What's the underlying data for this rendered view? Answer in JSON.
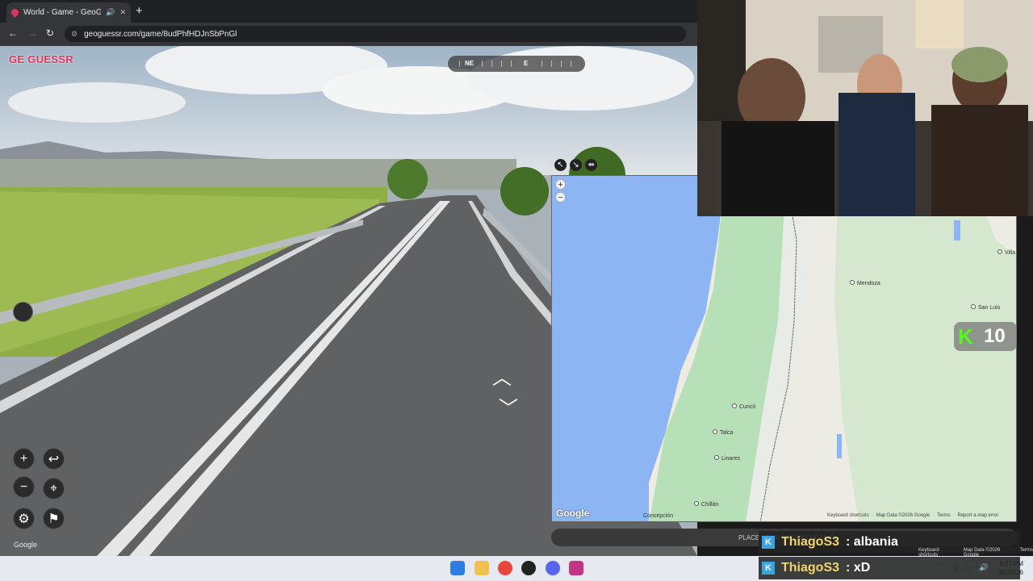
{
  "browser": {
    "tab_title": "World - Game - GeoGuessr",
    "tab_audio_icon": "speaker-icon",
    "tab_close": "✕",
    "new_tab": "+",
    "url": "geoguessr.com/game/8udPhfHDJnSbPnGl"
  },
  "game": {
    "logo": "GE GUESSR",
    "compass": {
      "left_label": "NE",
      "right_label": "E"
    },
    "street_google": "Google"
  },
  "map": {
    "cities": [
      "Mendoza",
      "San Luis",
      "Villa",
      "Curicó",
      "Talca",
      "Linares",
      "Chillán",
      "Concepción"
    ],
    "google_logo": "Google",
    "footer": [
      "Keyboard shortcuts",
      "Map Data ©2026 Google",
      "Terms",
      "Report a map error"
    ],
    "guess_placeholder": "PLACE YOUR PIN ON THE MAP"
  },
  "kick": {
    "viewers": "10"
  },
  "chat": [
    {
      "user": "ThiagoS3",
      "message": ": albania"
    },
    {
      "user": "ThiagoS3",
      "message": ": xD"
    }
  ],
  "overlay_footer": [
    "Keyboard shortcuts",
    "Map Data ©2026 Google",
    "Terms"
  ],
  "taskbar": {
    "time": "8:27 PM",
    "date": "3/2/2026"
  }
}
